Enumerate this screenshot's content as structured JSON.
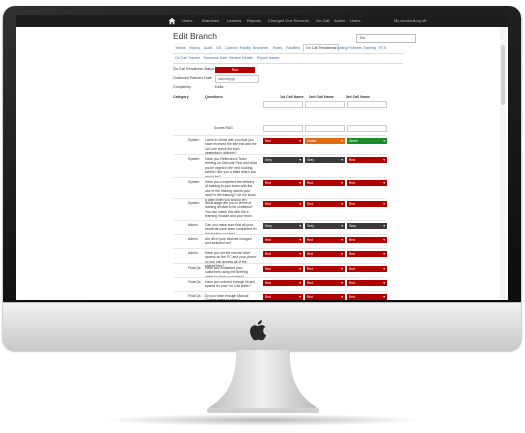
{
  "topnav": {
    "items": [
      "Users",
      "Branches",
      "Leavers",
      "Reports",
      "Changed Due Records",
      "On Call",
      "Admin",
      "Users"
    ],
    "right": [
      "My Account",
      "Log off"
    ]
  },
  "page": {
    "title": "Edit Branch",
    "branch_select": "Sw"
  },
  "tabs_row1": [
    "Teams",
    "History",
    "Audit",
    "GE",
    "Carbon / Facility",
    "Branches",
    "Roles",
    "Facilities",
    "On Call Readiness",
    "Guiding Partners",
    "Training",
    "RTS"
  ],
  "active_tab_index": 8,
  "tabs_row2": [
    "On Call Tracker",
    "Tomorrow Date",
    "Service Details",
    "Report Issues"
  ],
  "form": {
    "readiness_label": "On Call Readiness Status",
    "readiness_value": "Red",
    "outbound_label": "Outbound Partners Date",
    "outbound_value": "dd/mm/yyyy",
    "complexity_label": "Complexity",
    "complexity_value": "Delta"
  },
  "table": {
    "headers": [
      "Category",
      "Questions",
      "1st Call Name",
      "2nd Call Name",
      "3rd Call Name"
    ],
    "scoreboard_label": "Scores RAG",
    "rows": [
      {
        "category": "System",
        "question": "I wish to check with you that you have received the site info and the 1st Line check list from yesterday's delivery?",
        "values": [
          {
            "label": "Red",
            "color": "#b00000"
          },
          {
            "label": "Amber",
            "color": "#e06a10"
          },
          {
            "label": "Green",
            "color": "#1f8a2b"
          }
        ]
      },
      {
        "category": "System",
        "question": "Have you Reflected a Team briefing on Outcode Plus and what you're urged in the next rushing weeks? Are you a Mate which you would be?",
        "values": [
          {
            "label": "Grey",
            "color": "#3a3a3a"
          },
          {
            "label": "Grey",
            "color": "#3a3a3a"
          },
          {
            "label": "Red",
            "color": "#b00000"
          }
        ]
      },
      {
        "category": "System",
        "question": "Have you completed the delivery of training to your team with the use of the training videos your used in the training? Let me know a date when you should be?",
        "values": [
          {
            "label": "Red",
            "color": "#b00000"
          },
          {
            "label": "Red",
            "color": "#b00000"
          },
          {
            "label": "Red",
            "color": "#b00000"
          }
        ]
      },
      {
        "category": "System",
        "question": "What stage are you in terms of training all staff to be confident? You can check this with the e-learning module and your team.",
        "values": [
          {
            "label": "Red",
            "color": "#b00000"
          },
          {
            "label": "Red",
            "color": "#b00000"
          },
          {
            "label": "Red",
            "color": "#b00000"
          }
        ]
      },
      {
        "category": "Admin",
        "question": "Can you make sure that all your incidents have been completed on the system on time?",
        "values": [
          {
            "label": "Grey",
            "color": "#3a3a3a"
          },
          {
            "label": "Grey",
            "color": "#3a3a3a"
          },
          {
            "label": "Grey",
            "color": "#3a3a3a"
          }
        ]
      },
      {
        "category": "Admin",
        "question": "Are all of your devices charged and switched on?",
        "values": [
          {
            "label": "Red",
            "color": "#b00000"
          },
          {
            "label": "Red",
            "color": "#b00000"
          },
          {
            "label": "Red",
            "color": "#b00000"
          }
        ]
      },
      {
        "category": "Admin",
        "question": "Have you set the remote drive access on the PC and your phone so you can access all of the shared files?",
        "values": [
          {
            "label": "Red",
            "color": "#b00000"
          },
          {
            "label": "Red",
            "color": "#b00000"
          },
          {
            "label": "Red",
            "color": "#b00000"
          }
        ]
      },
      {
        "category": "Final Qs",
        "question": "Have you contacted your customers using the Briefing sheet for their customers?",
        "values": [
          {
            "label": "Red",
            "color": "#b00000"
          },
          {
            "label": "Red",
            "color": "#b00000"
          },
          {
            "label": "Red",
            "color": "#b00000"
          }
        ]
      },
      {
        "category": "Final Qs",
        "question": "Have you ordered enough kit and spares for your On Call shifts?",
        "values": [
          {
            "label": "Red",
            "color": "#b00000"
          },
          {
            "label": "Red",
            "color": "#b00000"
          },
          {
            "label": "Red",
            "color": "#b00000"
          }
        ]
      },
      {
        "category": "Final Qs",
        "question": "Do you have enough Manual Charge forms in stock?",
        "values": [
          {
            "label": "Red",
            "color": "#b00000"
          },
          {
            "label": "Red",
            "color": "#b00000"
          },
          {
            "label": "Red",
            "color": "#b00000"
          }
        ]
      }
    ]
  }
}
